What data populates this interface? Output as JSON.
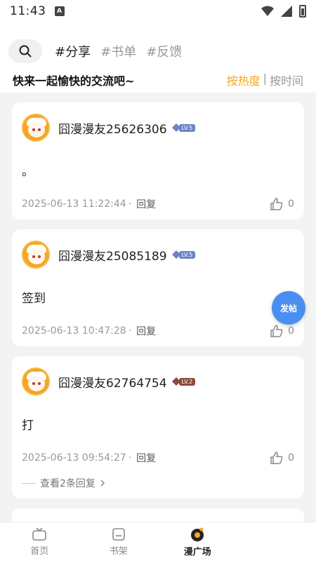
{
  "status_bar": {
    "time": "11:43",
    "notif": "A"
  },
  "header": {
    "tags": [
      "#分享",
      "#书单",
      "#反馈"
    ],
    "subtitle": "快来一起愉快的交流吧~",
    "sort": {
      "hot": "按热度",
      "sep": "|",
      "time": "按时间"
    }
  },
  "posts": [
    {
      "user": "囧漫漫友25626306",
      "level": "LV.5",
      "content": "。",
      "time": "2025-06-13 11:22:44",
      "reply": "回复",
      "likes": "0"
    },
    {
      "user": "囧漫漫友25085189",
      "level": "LV.5",
      "content": "签到",
      "time": "2025-06-13 10:47:28",
      "reply": "回复",
      "likes": "0"
    },
    {
      "user": "囧漫漫友62764754",
      "level": "LV.2",
      "content": "打",
      "time": "2025-06-13 09:54:27",
      "reply": "回复",
      "likes": "0",
      "sub_replies": "查看2条回复"
    }
  ],
  "fab": {
    "label": "发帖"
  },
  "tabbar": [
    {
      "label": "首页"
    },
    {
      "label": "书架"
    },
    {
      "label": "漫广场"
    }
  ],
  "colors": {
    "accent": "#f5a623",
    "lv5": "#6b84c4",
    "lv2": "#8b4a3c",
    "fab": "#4a8ff0"
  }
}
